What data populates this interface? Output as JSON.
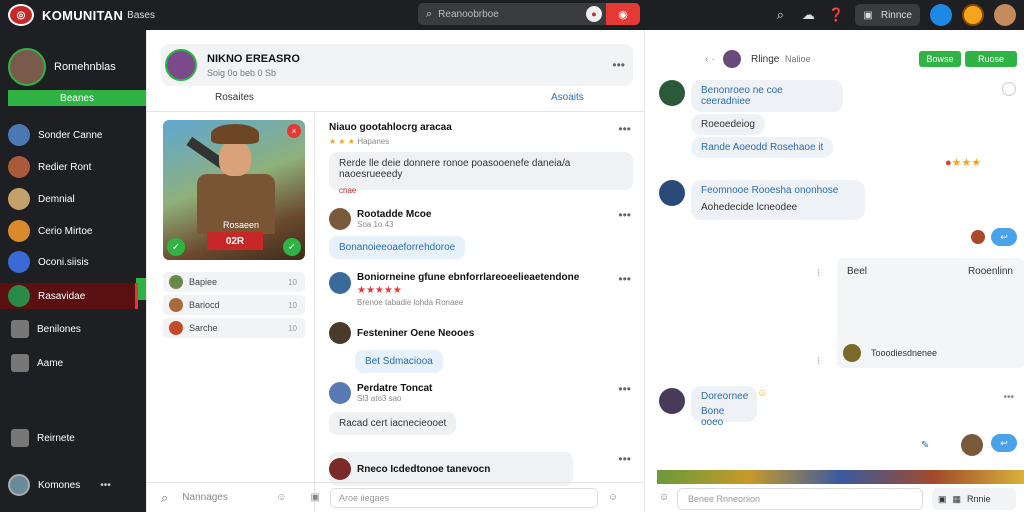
{
  "app": {
    "title": "KOMUNITAN",
    "subtitle": "Bases"
  },
  "search": {
    "placeholder": "Reanoobrboe"
  },
  "topbar": {
    "pill_label": "Rinnce"
  },
  "sidebar": {
    "profile_name": "Romehnblas",
    "profile_button": "Beanes",
    "items": [
      {
        "label": "Sonder Canne"
      },
      {
        "label": "Redier Ront"
      },
      {
        "label": "Demnial"
      },
      {
        "label": "Cerio Mirtoe"
      },
      {
        "label": "Oconi.siisis"
      },
      {
        "label": "Rasavidae"
      },
      {
        "label": "Benilones"
      },
      {
        "label": "Aame"
      },
      {
        "label": "Reirnete"
      },
      {
        "label": "Komones"
      }
    ]
  },
  "main": {
    "header": {
      "title": "NIKNO EREASRO",
      "meta": "Soig 0o beb 0 Sb"
    },
    "tabs": [
      {
        "label": "Rosaites"
      },
      {
        "label": "Asoaits"
      }
    ],
    "hero": {
      "name": "Rosaeen",
      "badge": "02R"
    },
    "mini_items": [
      {
        "label": "Bapiee",
        "count": "10"
      },
      {
        "label": "Bariocd",
        "count": "10"
      },
      {
        "label": "Sarche",
        "count": "10"
      }
    ],
    "posts": [
      {
        "name": "Niauo gootahlocrg aracaa",
        "sub": "Hapanes",
        "text": "Rerde lle deie donnere ronoe poasooenefe daneia/a naoesrueeedy",
        "tag": "cnae"
      },
      {
        "name": "Rootadde Mcoe",
        "sub": "Soa 1o 43",
        "text": "Bonanoieeoaeforrehdoroe"
      },
      {
        "name": "Boniorneine gfune ebnforrlareoeelieaetendone",
        "sub": "Brenoe tabadie lohda Ronaee"
      },
      {
        "name": "Festeniner Oene Neooes",
        "text": "Bet Sdmaciooa"
      },
      {
        "name": "Perdatre Toncat",
        "sub": "Sl3 ato3 sao",
        "text": "Racad cert iacnecieooet"
      },
      {
        "name": "Rneco Icdedtonoe tanevocn"
      }
    ],
    "composer_placeholder": "Nannages",
    "reply_placeholder": "Aroe iiegaes"
  },
  "chat": {
    "header_name": "Rlinge",
    "header_tag": "Nalioe",
    "buttons": [
      "Bowse",
      "Ruose"
    ],
    "messages": [
      {
        "lines": [
          "Benonroeo ne coe ceeradniee",
          "Roeoedeiog",
          "Rande Aoeodd Rosehaoe it"
        ]
      },
      {
        "lines": [
          "Feomnooe Rooesha ononhose",
          "Aohedecide lcneodee"
        ]
      },
      {
        "lines": [
          "Doreornee",
          "Bone ooeo"
        ]
      }
    ],
    "panel": {
      "left": "Beel",
      "right": "Rooenlinn",
      "footer": "Tooodiesdnenee"
    },
    "input_placeholder": "Benee Rnneonion",
    "send_label": "Rnnie"
  }
}
